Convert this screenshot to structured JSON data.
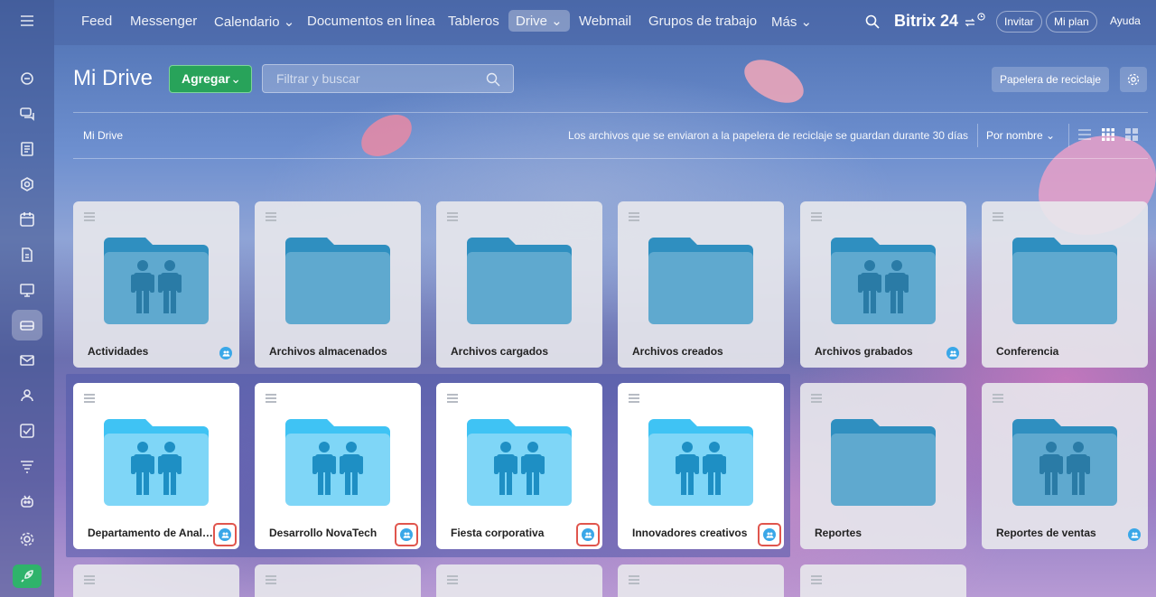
{
  "topbar": {
    "nav": [
      {
        "label": "Feed"
      },
      {
        "label": "Messenger"
      },
      {
        "label": "Calendario ⌄"
      },
      {
        "label": "Documentos en línea"
      },
      {
        "label": "Tableros"
      },
      {
        "label": "Drive ⌄"
      },
      {
        "label": "Webmail"
      },
      {
        "label": "Grupos de trabajo"
      },
      {
        "label": "Más ⌄"
      }
    ],
    "brand": "Bitrix 24",
    "invite_label": "Invitar",
    "plan_label": "Mi plan",
    "help_label": "Ayuda"
  },
  "header": {
    "title": "Mi Drive",
    "add_label": "Agregar",
    "add_caret": "⌄",
    "filter_placeholder": "Filtrar y buscar",
    "trash_label": "Papelera de reciclaje"
  },
  "toolbar": {
    "breadcrumb": "Mi Drive",
    "notice": "Los archivos que se enviaron a la papelera de reciclaje se guardan durante 30 días",
    "sort_label": "Por nombre ⌄"
  },
  "folders": [
    {
      "name": "Actividades",
      "shared": true,
      "people_icon": true
    },
    {
      "name": "Archivos almacenados",
      "shared": false,
      "people_icon": false
    },
    {
      "name": "Archivos cargados",
      "shared": false,
      "people_icon": false
    },
    {
      "name": "Archivos creados",
      "shared": false,
      "people_icon": false
    },
    {
      "name": "Archivos grabados",
      "shared": true,
      "people_icon": true
    },
    {
      "name": "Conferencia",
      "shared": false,
      "people_icon": false
    },
    {
      "name": "Departamento de Analíti...",
      "shared": true,
      "people_icon": true,
      "highlighted": true
    },
    {
      "name": "Desarrollo NovaTech",
      "shared": true,
      "people_icon": true,
      "highlighted": true
    },
    {
      "name": "Fiesta corporativa",
      "shared": true,
      "people_icon": true,
      "highlighted": true
    },
    {
      "name": "Innovadores creativos",
      "shared": true,
      "people_icon": true,
      "highlighted": true
    },
    {
      "name": "Reportes",
      "shared": false,
      "people_icon": false
    },
    {
      "name": "Reportes de ventas",
      "shared": true,
      "people_icon": true
    }
  ],
  "colors": {
    "accent_green": "#28a35a",
    "folder_grey_blue": "#5fa9cf",
    "folder_bright": "#7fd6f7",
    "shared_badge": "#3aa7e8",
    "highlight_box": "#e0554d"
  }
}
